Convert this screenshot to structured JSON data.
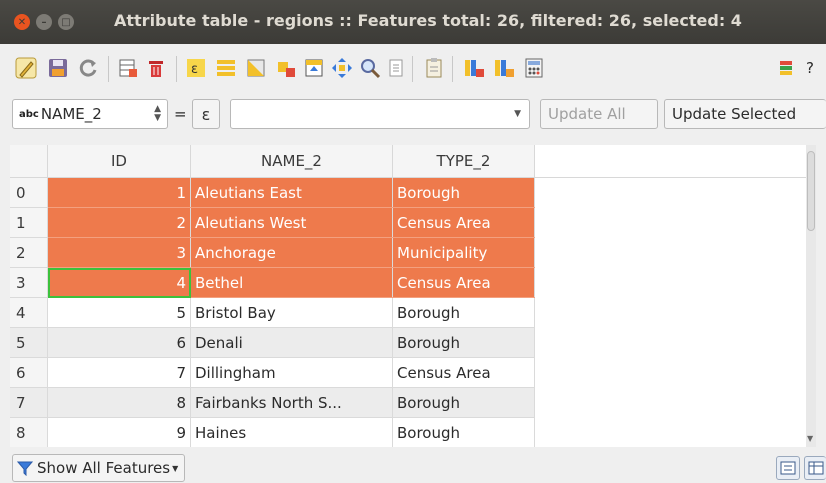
{
  "window": {
    "title": "Attribute table - regions :: Features total: 26, filtered: 26, selected: 4",
    "controls": [
      "close",
      "minimize",
      "maximize"
    ]
  },
  "toolbar": {
    "buttons": [
      {
        "name": "toggle-editing-icon"
      },
      {
        "name": "save-edits-icon"
      },
      {
        "name": "reload-table-icon"
      },
      {
        "name": "add-feature-icon"
      },
      {
        "name": "delete-selected-icon"
      },
      {
        "name": "select-by-expression-icon"
      },
      {
        "name": "select-all-icon"
      },
      {
        "name": "invert-selection-icon"
      },
      {
        "name": "deselect-all-icon"
      },
      {
        "name": "move-selection-to-top-icon"
      },
      {
        "name": "pan-to-selected-icon"
      },
      {
        "name": "zoom-to-selected-icon"
      },
      {
        "name": "copy-selected-rows-icon"
      },
      {
        "name": "paste-features-icon"
      },
      {
        "name": "delete-field-icon"
      },
      {
        "name": "new-field-icon"
      },
      {
        "name": "field-calculator-icon"
      },
      {
        "name": "conditional-formatting-icon"
      },
      {
        "name": "help-icon"
      }
    ],
    "help_label": "?"
  },
  "expression_bar": {
    "field_type_badge": "abc",
    "field_name": "NAME_2",
    "equals": "=",
    "epsilon": "ε",
    "expression_value": "",
    "update_all_label": "Update All",
    "update_selected_label": "Update Selected"
  },
  "table": {
    "columns": [
      "ID",
      "NAME_2",
      "TYPE_2"
    ],
    "rows": [
      {
        "row": "0",
        "id": "1",
        "name": "Aleutians East",
        "type": "Borough",
        "selected": true
      },
      {
        "row": "1",
        "id": "2",
        "name": "Aleutians West",
        "type": "Census Area",
        "selected": true
      },
      {
        "row": "2",
        "id": "3",
        "name": "Anchorage",
        "type": "Municipality",
        "selected": true
      },
      {
        "row": "3",
        "id": "4",
        "name": "Bethel",
        "type": "Census Area",
        "selected": true
      },
      {
        "row": "4",
        "id": "5",
        "name": "Bristol Bay",
        "type": "Borough",
        "selected": false
      },
      {
        "row": "5",
        "id": "6",
        "name": "Denali",
        "type": "Borough",
        "selected": false
      },
      {
        "row": "6",
        "id": "7",
        "name": "Dillingham",
        "type": "Census Area",
        "selected": false
      },
      {
        "row": "7",
        "id": "8",
        "name": "Fairbanks North S...",
        "type": "Borough",
        "selected": false
      },
      {
        "row": "8",
        "id": "9",
        "name": "Haines",
        "type": "Borough",
        "selected": false
      }
    ]
  },
  "statusbar": {
    "filter_label": "Show All Features",
    "views": [
      "table-view-icon",
      "form-view-icon"
    ]
  },
  "colors": {
    "selection": "#ee7a4c",
    "titlebar": "#3c3b37",
    "close_button": "#e95420",
    "current_cell_outline": "#3cc13c"
  }
}
